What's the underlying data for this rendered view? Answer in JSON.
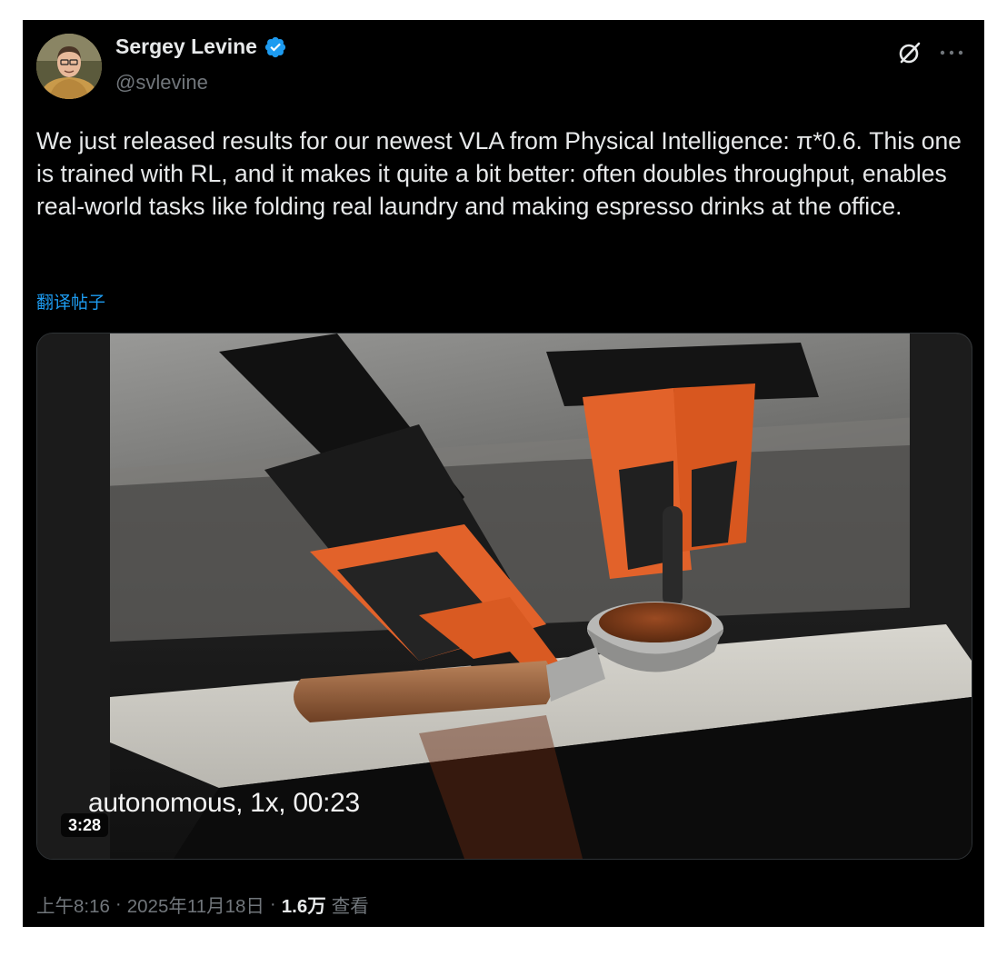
{
  "author": {
    "display_name": "Sergey Levine",
    "handle": "@svlevine",
    "verified": true,
    "avatar_icon": "user-avatar"
  },
  "header_actions": {
    "grok_icon": "grok-icon",
    "more_icon": "more-dots-icon",
    "more_glyph": "···"
  },
  "tweet": {
    "text": "We just released results for our newest VLA from Physical Intelligence: π*0.6. This one is trained with RL, and it makes it quite a bit better: often doubles throughput, enables real-world tasks like folding real laundry and making espresso drinks at the office.",
    "translate_label": "翻译帖子"
  },
  "media": {
    "type": "video",
    "caption_overlay": "autonomous, 1x, 00:23",
    "duration": "3:28"
  },
  "meta": {
    "time": "上午8:16",
    "separator": "·",
    "date": "2025年11月18日",
    "views_count": "1.6万",
    "views_label": "查看"
  },
  "colors": {
    "background": "#000000",
    "text": "#e7e9ea",
    "muted": "#71767b",
    "link": "#1d9bf0",
    "verified": "#1d9bf0"
  }
}
